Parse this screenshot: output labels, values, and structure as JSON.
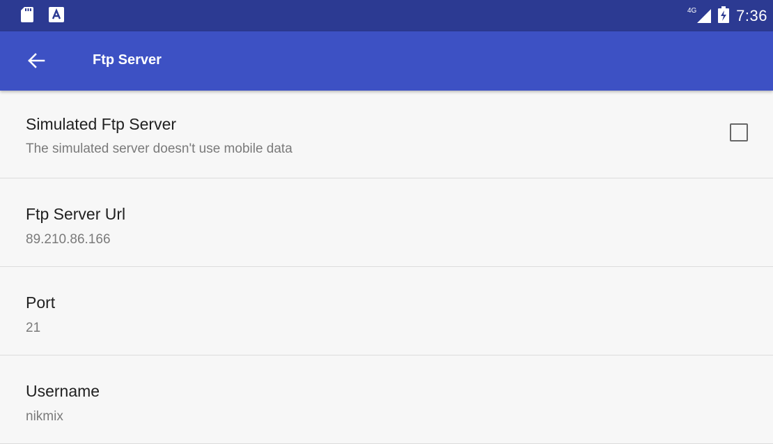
{
  "status_bar": {
    "time": "7:36",
    "network_label": "4G",
    "icons": [
      "sd-card-icon",
      "a-notification-icon",
      "signal-icon",
      "battery-icon"
    ]
  },
  "app_bar": {
    "title": "Ftp Server",
    "back_icon": "arrow-left-icon"
  },
  "preferences": [
    {
      "title": "Simulated Ftp Server",
      "summary": "The simulated server doesn't use mobile data",
      "checked": false
    },
    {
      "title": "Ftp Server Url",
      "summary": "89.210.86.166"
    },
    {
      "title": "Port",
      "summary": "21"
    },
    {
      "title": "Username",
      "summary": "nikmix"
    }
  ],
  "colors": {
    "status_bar": "#2c3a92",
    "app_bar": "#3d51c4",
    "background": "#f7f7f7",
    "title_text": "#212121",
    "summary_text": "#7a7a7a"
  }
}
